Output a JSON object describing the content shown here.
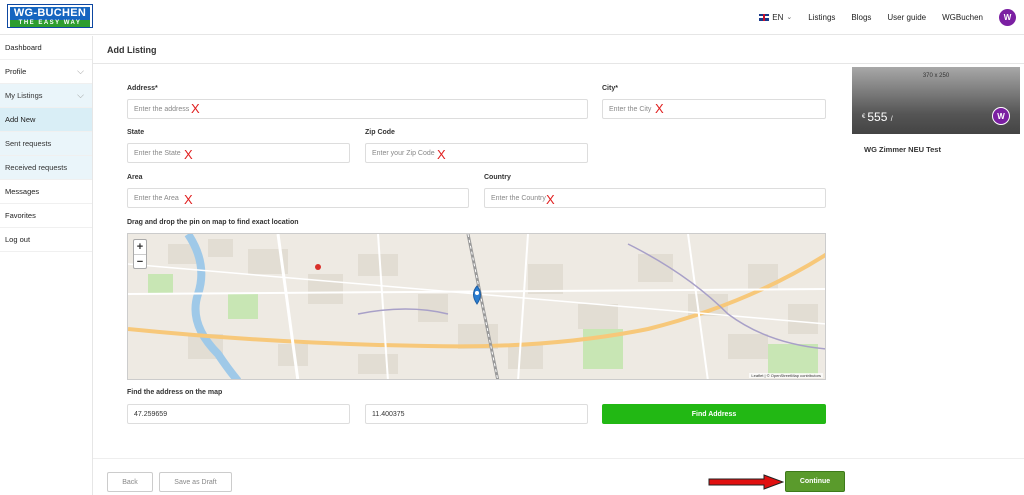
{
  "brand": {
    "name": "WG-BUCHEN",
    "tagline": "THE EASY WAY"
  },
  "header": {
    "lang": "EN",
    "nav": [
      "Listings",
      "Blogs",
      "User guide",
      "WGBuchen"
    ],
    "avatar_initial": "W"
  },
  "sidebar": {
    "items": [
      {
        "label": "Dashboard"
      },
      {
        "label": "Profile",
        "has_chevron": true
      },
      {
        "label": "My Listings",
        "has_chevron": true,
        "expanded": true
      },
      {
        "label": "Add New",
        "active": true
      },
      {
        "label": "Sent requests"
      },
      {
        "label": "Received requests"
      },
      {
        "label": "Messages"
      },
      {
        "label": "Favorites"
      },
      {
        "label": "Log out"
      }
    ]
  },
  "page": {
    "title": "Add Listing"
  },
  "form": {
    "address": {
      "label": "Address*",
      "placeholder": "Enter the address"
    },
    "city": {
      "label": "City*",
      "placeholder": "Enter the City"
    },
    "state": {
      "label": "State",
      "placeholder": "Enter the State"
    },
    "zip": {
      "label": "Zip Code",
      "placeholder": "Enter your Zip Code"
    },
    "area": {
      "label": "Area",
      "placeholder": "Enter the Area"
    },
    "country": {
      "label": "Country",
      "placeholder": "Enter the Country"
    },
    "map_hint": "Drag and drop the pin on map to find exact location",
    "find_label": "Find the address on the map",
    "latitude": "47.259659",
    "longitude": "11.400375",
    "find_button": "Find Address",
    "error_mark": "X"
  },
  "map": {
    "zoom_in": "+",
    "zoom_out": "−",
    "attribution": "Leaflet | © OpenStreetMap contributors",
    "labels": [
      "Innsbruck Hauptbahnhof",
      "Innsbruck Hötting",
      "Amraser-See-Straße",
      "Wilten",
      "B174",
      "L11"
    ]
  },
  "card": {
    "image_size": "370 x 250",
    "currency": "€",
    "price": "555",
    "price_suffix": "/",
    "avatar_initial": "W",
    "title": "WG Zimmer NEU Test"
  },
  "footer": {
    "back": "Back",
    "draft": "Save as Draft",
    "continue": "Continue"
  },
  "colors": {
    "accent_green": "#22b814",
    "continue_green": "#5a9b2c",
    "brand_blue": "#1565c0",
    "avatar_purple": "#7b1fa2",
    "error_red": "#e02020",
    "arrow_red": "#e01010"
  }
}
